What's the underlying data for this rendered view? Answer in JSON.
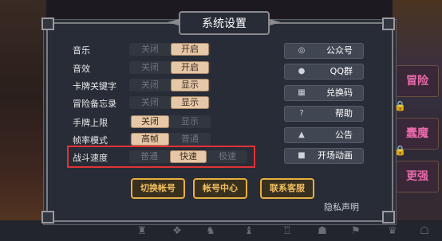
{
  "dialog": {
    "title": "系统设置"
  },
  "settings": [
    {
      "label": "音乐",
      "options": [
        "关闭",
        "开启"
      ],
      "selected": 1
    },
    {
      "label": "音效",
      "options": [
        "关闭",
        "开启"
      ],
      "selected": 1
    },
    {
      "label": "卡牌关键字",
      "options": [
        "关闭",
        "显示"
      ],
      "selected": 1
    },
    {
      "label": "冒险备忘录",
      "options": [
        "关闭",
        "显示"
      ],
      "selected": 1
    },
    {
      "label": "手牌上限",
      "options": [
        "关闭",
        "显示"
      ],
      "selected": 0
    },
    {
      "label": "帧率模式",
      "options": [
        "高帧",
        "普通"
      ],
      "selected": 0
    }
  ],
  "speed": {
    "label": "战斗速度",
    "options": [
      "普通",
      "快速",
      "极速"
    ],
    "selected": 1
  },
  "right_buttons": [
    {
      "label": "公众号",
      "icon": "wechat-icon"
    },
    {
      "label": "QQ群",
      "icon": "qq-icon"
    },
    {
      "label": "兑换码",
      "icon": "qrcode-icon"
    },
    {
      "label": "帮助",
      "icon": "help-icon"
    },
    {
      "label": "公告",
      "icon": "announcement-icon"
    },
    {
      "label": "开场动画",
      "icon": "video-icon"
    }
  ],
  "bottom_buttons": {
    "switch_account": "切换帐号",
    "account_center": "帐号中心",
    "contact_service": "联系客服"
  },
  "privacy": "隐私声明",
  "side_cards": [
    "冒险",
    "蠢魔",
    "更强"
  ],
  "colors": {
    "highlight": "#e23236",
    "accent_gold": "#e6b040",
    "toggle_on": "#e6c8a8"
  }
}
